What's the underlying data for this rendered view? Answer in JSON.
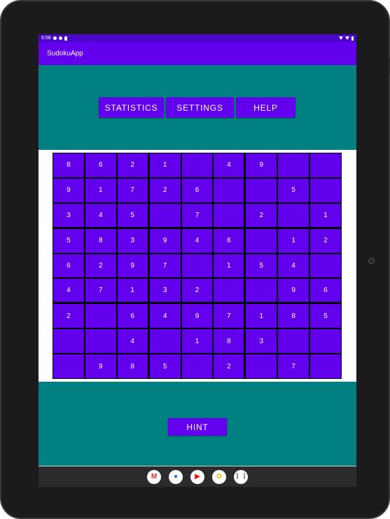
{
  "status_bar": {
    "time": "5:58"
  },
  "app": {
    "title": "SudokuApp"
  },
  "buttons": {
    "statistics": "STATISTICS",
    "settings": "SETTINGS",
    "help": "HELP",
    "hint": "HINT"
  },
  "colors": {
    "primary": "#6200ee",
    "panel": "#008080",
    "status": "#4a07c9"
  },
  "board": {
    "rows": [
      [
        "8",
        "6",
        "2",
        "1",
        "",
        "4",
        "9",
        "",
        ""
      ],
      [
        "9",
        "1",
        "7",
        "2",
        "6",
        "",
        "",
        "5",
        ""
      ],
      [
        "3",
        "4",
        "5",
        "",
        "7",
        "",
        "2",
        "",
        "1"
      ],
      [
        "5",
        "8",
        "3",
        "9",
        "4",
        "6",
        "",
        "1",
        "2"
      ],
      [
        "6",
        "2",
        "9",
        "7",
        "",
        "1",
        "5",
        "4",
        ""
      ],
      [
        "4",
        "7",
        "1",
        "3",
        "2",
        "",
        "",
        "9",
        "6"
      ],
      [
        "2",
        "",
        "6",
        "4",
        "9",
        "7",
        "1",
        "8",
        "5"
      ],
      [
        "",
        "",
        "4",
        "",
        "1",
        "8",
        "3",
        "",
        ""
      ],
      [
        "",
        "9",
        "8",
        "5",
        "",
        "2",
        "",
        "7",
        ""
      ]
    ]
  },
  "dock": {
    "apps": [
      {
        "name": "gmail-icon",
        "glyph": "M",
        "color": "#d93025"
      },
      {
        "name": "chrome-icon",
        "glyph": "●",
        "color": "#1a73e8"
      },
      {
        "name": "youtube-icon",
        "glyph": "▶",
        "color": "#ff0000"
      },
      {
        "name": "photos-icon",
        "glyph": "✿",
        "color": "#fbbc04"
      },
      {
        "name": "app-drawer-icon",
        "glyph": "⋮⋮",
        "color": "#444444"
      }
    ]
  }
}
